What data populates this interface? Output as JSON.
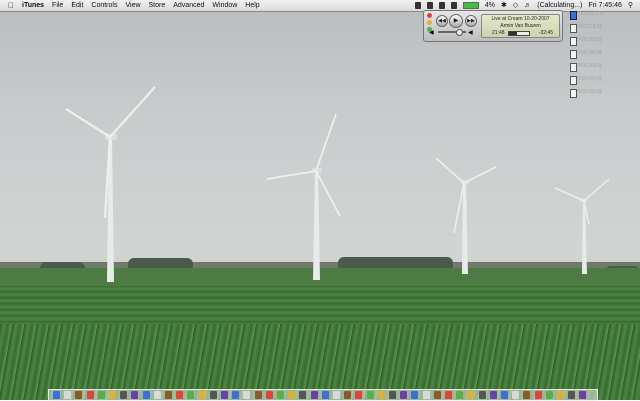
{
  "menubar": {
    "app": "iTunes",
    "menus": [
      "File",
      "Edit",
      "Controls",
      "View",
      "Store",
      "Advanced",
      "Window",
      "Help"
    ],
    "status_text": "(Calculating...)",
    "clock": "Fri 7:45:46",
    "battery_indicator": "4%"
  },
  "player": {
    "track": "Live at Cream 10-20-2007",
    "artist": "Armin Van Buuren",
    "elapsed": "21:48",
    "remaining": "-32:45",
    "progress": 0.4,
    "volume": 0.75
  },
  "desktop_icons": [
    {
      "type": "disk",
      "label": "Macintosh HD"
    },
    {
      "type": "document",
      "label": "Picture 1.png"
    },
    {
      "type": "document",
      "label": "Picture 2.png"
    },
    {
      "type": "document",
      "label": "Picture 3.png"
    },
    {
      "type": "document",
      "label": "Picture 4.png"
    },
    {
      "type": "document",
      "label": "Picture 5.png"
    },
    {
      "type": "document",
      "label": "Picture 6.png"
    }
  ],
  "dock": {
    "item_count": 48,
    "colors": [
      "#3b6fd6",
      "#d9d9d9",
      "#8a5a2a",
      "#e0443e",
      "#55b048",
      "#dcb13b",
      "#555555",
      "#6a3fa6"
    ]
  },
  "colors": {
    "menubar": "#e8e8e8",
    "sky": "#c9cccd",
    "field": "#4c8740"
  }
}
